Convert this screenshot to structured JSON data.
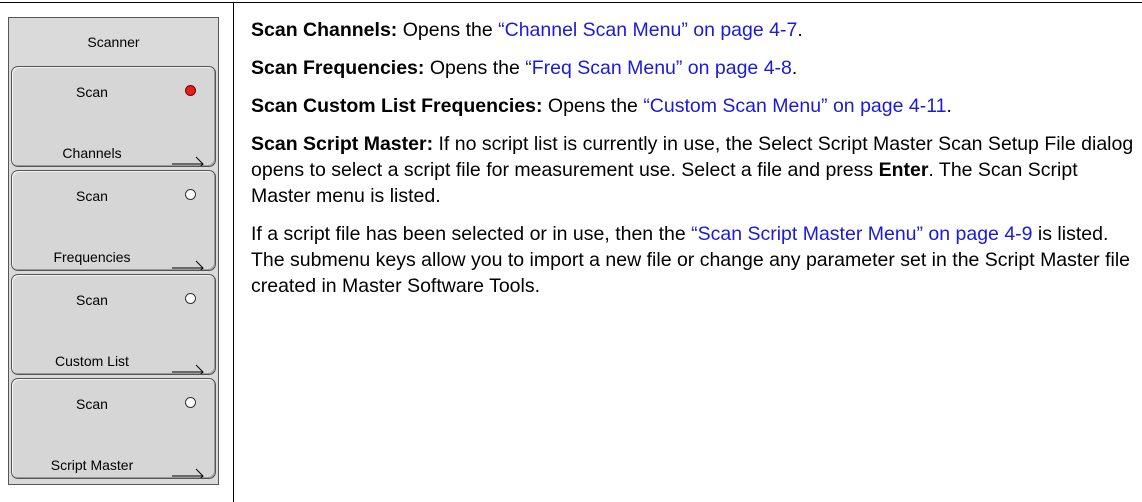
{
  "menu": {
    "title": "Scanner",
    "keys": [
      {
        "top": "Scan",
        "bottom": "Channels",
        "indicator": "active"
      },
      {
        "top": "Scan",
        "bottom": "Frequencies",
        "indicator": "inactive"
      },
      {
        "top": "Scan",
        "bottom": "Custom List",
        "indicator": "inactive"
      },
      {
        "top": "Scan",
        "bottom": "Script Master",
        "indicator": "inactive"
      }
    ],
    "colors": {
      "active_led": "#e61e1e",
      "link": "#1a1adc"
    }
  },
  "content": {
    "p1": {
      "term": "Scan Channels:",
      "text1": " Opens the ",
      "link": "“Channel Scan Menu” on page 4-7",
      "end": "."
    },
    "p2": {
      "term": "Scan Frequencies:",
      "text1": " Opens the ",
      "link": "“Freq Scan Menu” on page 4-8",
      "end": "."
    },
    "p3": {
      "term": "Scan Custom List Frequencies:",
      "text1": " Opens the ",
      "link": "“Custom Scan Menu” on page 4-11",
      "end": "."
    },
    "p4": {
      "term": "Scan Script Master:",
      "text1": " If no script list is currently in use, the Select Script Master Scan Setup File dialog opens to select a script file for measurement use. Select a file and press ",
      "bold": "Enter",
      "text2": ". The Scan Script Master menu is listed."
    },
    "p5": {
      "text1": "If a script file has been selected or in use, then the ",
      "link": "“Scan Script Master Menu” on page 4-9",
      "text2": " is listed. The submenu keys allow you to import a new file or change any parameter set in the Script Master file created in Master Software Tools."
    }
  }
}
